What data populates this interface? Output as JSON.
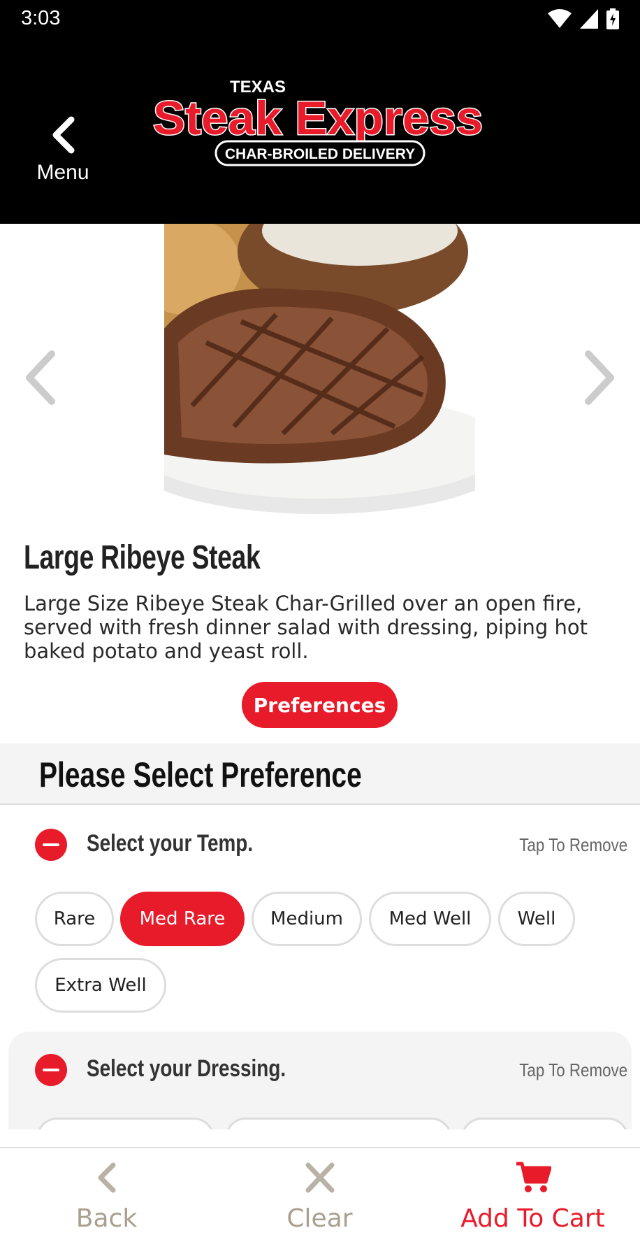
{
  "status_bar": {
    "time": "3:03"
  },
  "header": {
    "back_label": "Menu",
    "logo": {
      "top": "TEXAS",
      "main": "Steak Express",
      "sub": "CHAR-BROILED DELIVERY"
    }
  },
  "item": {
    "title": "Large Ribeye Steak",
    "description": "Large Size Ribeye Steak Char-Grilled over an open fire, served with fresh dinner salad with dressing, piping hot baked potato and yeast roll.",
    "preferences_button": "Preferences"
  },
  "preferences": {
    "heading": "Please Select Preference",
    "groups": [
      {
        "title": "Select your Temp.",
        "remove_label": "Tap To Remove",
        "options": [
          "Rare",
          "Med Rare",
          "Medium",
          "Med Well",
          "Well",
          "Extra Well"
        ],
        "selected": "Med Rare"
      },
      {
        "title": "Select your Dressing.",
        "remove_label": "Tap To Remove"
      }
    ]
  },
  "bottom_bar": {
    "back": "Back",
    "clear": "Clear",
    "add_to_cart": "Add To Cart"
  },
  "colors": {
    "accent": "#e81b2a",
    "header_bg": "#000000",
    "muted": "#a89f8f"
  }
}
